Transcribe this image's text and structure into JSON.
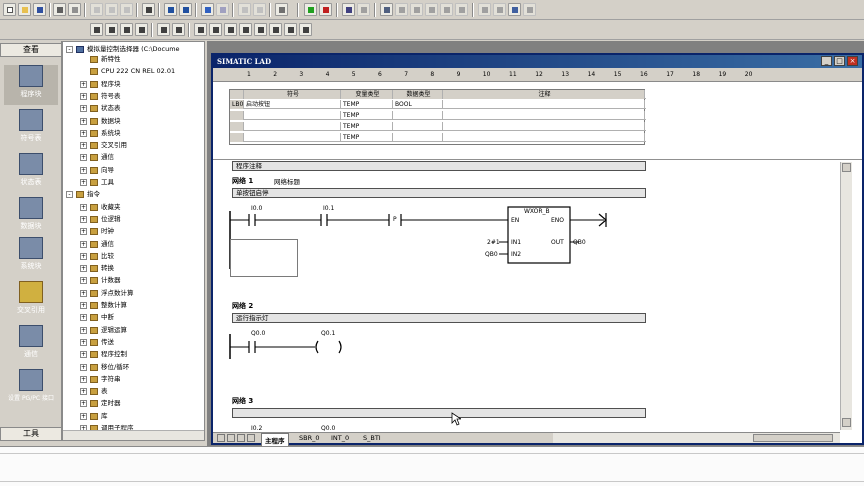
{
  "nav": {
    "header": "查看",
    "footer": "工具",
    "items": [
      {
        "label": "程序块",
        "icon": "program-block-icon"
      },
      {
        "label": "符号表",
        "icon": "symbol-table-icon"
      },
      {
        "label": "状态表",
        "icon": "status-table-icon"
      },
      {
        "label": "数据块",
        "icon": "data-block-icon"
      },
      {
        "label": "系统块",
        "icon": "system-block-icon"
      },
      {
        "label": "交叉引用",
        "icon": "cross-reference-icon"
      },
      {
        "label": "通信",
        "icon": "communication-icon"
      },
      {
        "label": "设置 PG/PC 接口",
        "icon": "pgpc-interface-icon"
      }
    ]
  },
  "tree": {
    "root": "模拟量控制选择器 (C:\\Docume",
    "items": [
      {
        "label": "新特性",
        "indent": 1,
        "pm": ""
      },
      {
        "label": "CPU 222 CN REL 02.01",
        "indent": 1,
        "pm": ""
      },
      {
        "label": "程序块",
        "indent": 1,
        "pm": "+"
      },
      {
        "label": "符号表",
        "indent": 1,
        "pm": "+"
      },
      {
        "label": "状态表",
        "indent": 1,
        "pm": "+"
      },
      {
        "label": "数据块",
        "indent": 1,
        "pm": "+"
      },
      {
        "label": "系统块",
        "indent": 1,
        "pm": "+"
      },
      {
        "label": "交叉引用",
        "indent": 1,
        "pm": "+"
      },
      {
        "label": "通信",
        "indent": 1,
        "pm": "+"
      },
      {
        "label": "向导",
        "indent": 1,
        "pm": "+"
      },
      {
        "label": "工具",
        "indent": 1,
        "pm": "+"
      },
      {
        "label": "指令",
        "indent": 0,
        "pm": "-"
      },
      {
        "label": "收藏夹",
        "indent": 1,
        "pm": "+"
      },
      {
        "label": "位逻辑",
        "indent": 1,
        "pm": "+"
      },
      {
        "label": "时钟",
        "indent": 1,
        "pm": "+"
      },
      {
        "label": "通信",
        "indent": 1,
        "pm": "+"
      },
      {
        "label": "比较",
        "indent": 1,
        "pm": "+"
      },
      {
        "label": "转换",
        "indent": 1,
        "pm": "+"
      },
      {
        "label": "计数器",
        "indent": 1,
        "pm": "+"
      },
      {
        "label": "浮点数计算",
        "indent": 1,
        "pm": "+"
      },
      {
        "label": "整数计算",
        "indent": 1,
        "pm": "+"
      },
      {
        "label": "中断",
        "indent": 1,
        "pm": "+"
      },
      {
        "label": "逻辑运算",
        "indent": 1,
        "pm": "+"
      },
      {
        "label": "传送",
        "indent": 1,
        "pm": "+"
      },
      {
        "label": "程序控制",
        "indent": 1,
        "pm": "+"
      },
      {
        "label": "移位/循环",
        "indent": 1,
        "pm": "+"
      },
      {
        "label": "字符串",
        "indent": 1,
        "pm": "+"
      },
      {
        "label": "表",
        "indent": 1,
        "pm": "+"
      },
      {
        "label": "定时器",
        "indent": 1,
        "pm": "+"
      },
      {
        "label": "库",
        "indent": 1,
        "pm": "+"
      },
      {
        "label": "调用子程序",
        "indent": 1,
        "pm": "+"
      }
    ]
  },
  "window": {
    "title": "SIMATIC LAD",
    "min": "_",
    "max": "□",
    "close": "×"
  },
  "ruler": [
    "1",
    "2",
    "3",
    "4",
    "5",
    "6",
    "7",
    "8",
    "9",
    "10",
    "11",
    "12",
    "13",
    "14",
    "15",
    "16",
    "17",
    "18",
    "19",
    "20"
  ],
  "vartable": {
    "headers": [
      "",
      "符号",
      "变量类型",
      "数据类型",
      "注释"
    ],
    "rows": [
      [
        "LB0",
        "启动按钮",
        "TEMP",
        "BOOL",
        ""
      ],
      [
        "",
        "",
        "TEMP",
        "",
        ""
      ],
      [
        "",
        "",
        "TEMP",
        "",
        ""
      ],
      [
        "",
        "",
        "TEMP",
        "",
        ""
      ]
    ]
  },
  "ladder": {
    "program_comment": "程序注释",
    "net1_label": "网络 1",
    "net1_title": "网络标题",
    "net1_comment": "单按钮启停",
    "contact1": "I0.0",
    "contact2": "I0.1",
    "pulse": "P",
    "block_name": "WXOR_B",
    "en": "EN",
    "eno": "ENO",
    "in1": "IN1",
    "in2": "IN2",
    "out": "OUT",
    "in1_val": "2#1",
    "in2_val": "QB0",
    "out_val": "QB0",
    "net2_label": "网络 2",
    "net2_comment": "运行指示灯",
    "net2_contact": "Q0.0",
    "net2_coil": "Q0.1",
    "net3_label": "网络 3",
    "net3_contact1": "I0.2",
    "net3_contact2": "Q0.0"
  },
  "tabs": [
    "主程序",
    "SBR_0",
    "INT_0",
    "S_BTI"
  ]
}
